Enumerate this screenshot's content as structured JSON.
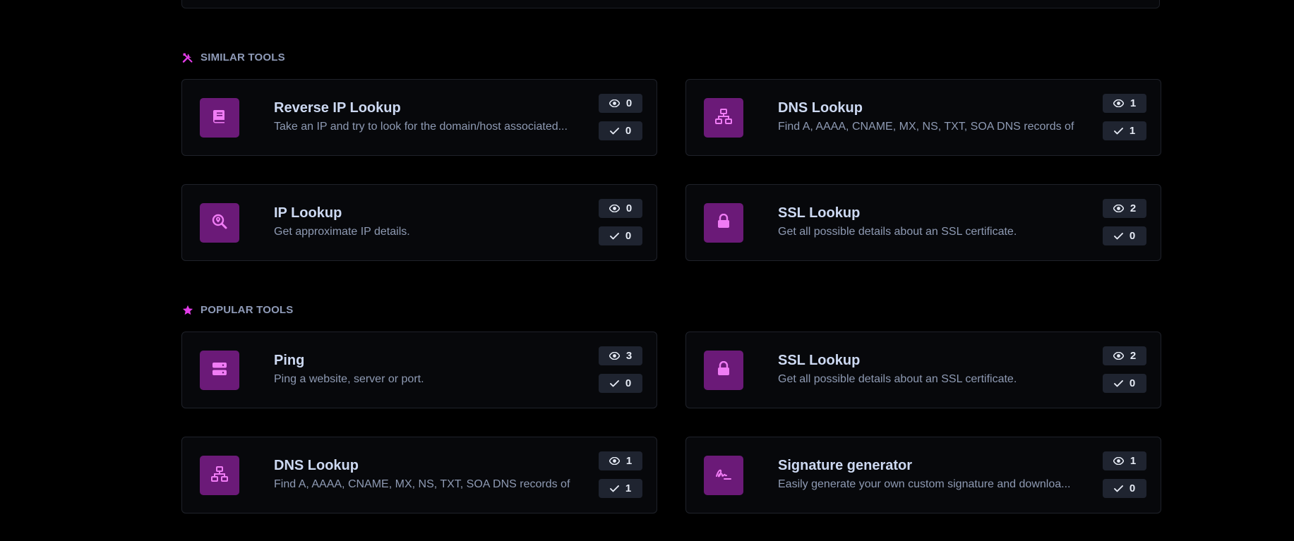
{
  "sections": [
    {
      "header": "SIMILAR TOOLS",
      "header_icon": "tools-icon",
      "cards": [
        {
          "title": "Reverse IP Lookup",
          "desc": "Take an IP and try to look for the domain/host associated...",
          "icon": "book-icon",
          "views": "0",
          "checks": "0"
        },
        {
          "title": "DNS Lookup",
          "desc": "Find A, AAAA, CNAME, MX, NS, TXT, SOA DNS records of...",
          "icon": "network-icon",
          "views": "1",
          "checks": "1"
        },
        {
          "title": "IP Lookup",
          "desc": "Get approximate IP details.",
          "icon": "search-location-icon",
          "views": "0",
          "checks": "0"
        },
        {
          "title": "SSL Lookup",
          "desc": "Get all possible details about an SSL certificate.",
          "icon": "lock-icon",
          "views": "2",
          "checks": "0"
        }
      ]
    },
    {
      "header": "POPULAR TOOLS",
      "header_icon": "star-icon",
      "cards": [
        {
          "title": "Ping",
          "desc": "Ping a website, server or port.",
          "icon": "server-icon",
          "views": "3",
          "checks": "0"
        },
        {
          "title": "SSL Lookup",
          "desc": "Get all possible details about an SSL certificate.",
          "icon": "lock-icon",
          "views": "2",
          "checks": "0"
        },
        {
          "title": "DNS Lookup",
          "desc": "Find A, AAAA, CNAME, MX, NS, TXT, SOA DNS records of...",
          "icon": "network-icon",
          "views": "1",
          "checks": "1"
        },
        {
          "title": "Signature generator",
          "desc": "Easily generate your own custom signature and downloa...",
          "icon": "signature-icon",
          "views": "1",
          "checks": "0"
        }
      ]
    }
  ],
  "colors": {
    "accent": "#e23ce8",
    "icon_bg": "#6b1a78",
    "icon_fg": "#f07cf5",
    "card_bg": "#07080b",
    "badge_bg": "#1f2430"
  }
}
